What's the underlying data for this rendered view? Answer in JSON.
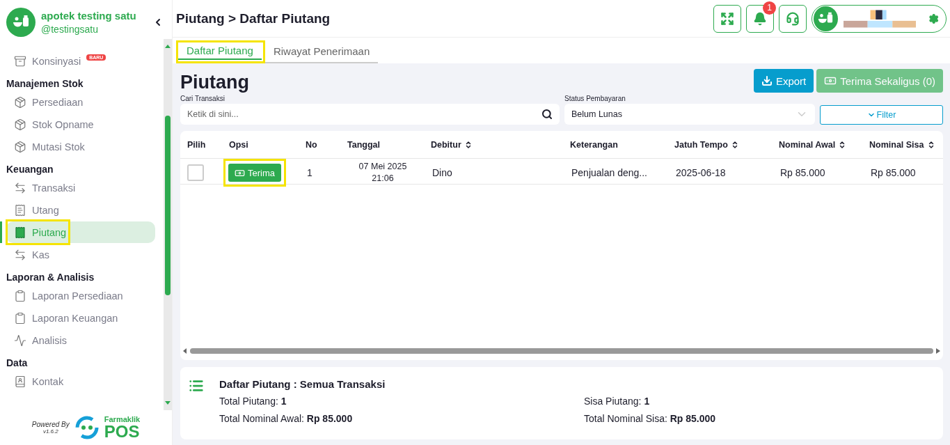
{
  "sidebar": {
    "store_name": "apotek testing satu",
    "handle": "@testingsatu",
    "sections": [
      {
        "items": [
          {
            "label": "Konsinyasi",
            "badge": "BARU",
            "selected": false,
            "highlighted": false
          }
        ]
      },
      {
        "heading": "Manajemen Stok",
        "items": [
          {
            "label": "Persediaan",
            "selected": false,
            "highlighted": false
          },
          {
            "label": "Stok Opname",
            "selected": false,
            "highlighted": false
          },
          {
            "label": "Mutasi Stok",
            "selected": false,
            "highlighted": false
          }
        ]
      },
      {
        "heading": "Keuangan",
        "items": [
          {
            "label": "Transaksi",
            "selected": false,
            "highlighted": false
          },
          {
            "label": "Utang",
            "selected": false,
            "highlighted": false
          },
          {
            "label": "Piutang",
            "selected": true,
            "highlighted": true
          },
          {
            "label": "Kas",
            "selected": false,
            "highlighted": false
          }
        ]
      },
      {
        "heading": "Laporan & Analisis",
        "items": [
          {
            "label": "Laporan Persediaan",
            "selected": false,
            "highlighted": false
          },
          {
            "label": "Laporan Keuangan",
            "selected": false,
            "highlighted": false
          },
          {
            "label": "Analisis",
            "selected": false,
            "highlighted": false
          }
        ]
      },
      {
        "heading": "Data",
        "items": [
          {
            "label": "Kontak",
            "selected": false,
            "highlighted": false
          }
        ]
      }
    ],
    "powered_by": "Powered By",
    "version": "v1.6.2",
    "brand": "Farmaklik",
    "brand_sub": "POS"
  },
  "header": {
    "breadcrumb": "Piutang > Daftar Piutang",
    "notification_count": "1"
  },
  "tabs": [
    {
      "label": "Daftar Piutang",
      "selected": true,
      "highlighted": true
    },
    {
      "label": "Riwayat Penerimaan",
      "selected": false,
      "highlighted": false
    }
  ],
  "page_title": "Piutang",
  "actions": [
    {
      "label": "Export",
      "kind": "export",
      "disabled": false
    },
    {
      "label": "Terima Sekaligus (0)",
      "kind": "receive",
      "disabled": true
    }
  ],
  "search": {
    "label": "Cari Transaksi",
    "placeholder": "Ketik di sini..."
  },
  "status_filter": {
    "label": "Status Pembayaran",
    "value": "Belum Lunas"
  },
  "filter_button": "Filter",
  "table": {
    "columns": [
      {
        "label": "Pilih",
        "sortable": false
      },
      {
        "label": "Opsi",
        "sortable": false
      },
      {
        "label": "No",
        "sortable": false
      },
      {
        "label": "Tanggal",
        "sortable": false
      },
      {
        "label": "Debitur",
        "sortable": true
      },
      {
        "label": "Keterangan",
        "sortable": false
      },
      {
        "label": "Jatuh Tempo",
        "sortable": true
      },
      {
        "label": "Nominal Awal",
        "sortable": true
      },
      {
        "label": "Nominal Sisa",
        "sortable": true
      }
    ],
    "rows": [
      {
        "checked": false,
        "action": "Terima",
        "action_highlighted": true,
        "no": "1",
        "date": "07 Mei 2025",
        "time": "21:06",
        "debtor": "Dino",
        "description": "Penjualan deng...",
        "due": "2025-06-18",
        "initial": "Rp 85.000",
        "remaining": "Rp 85.000"
      }
    ]
  },
  "summary": {
    "title": "Daftar Piutang : Semua Transaksi",
    "stats": [
      {
        "label": "Total Piutang: ",
        "value": "1"
      },
      {
        "label": "Sisa Piutang: ",
        "value": "1"
      },
      {
        "label": "Total Nominal Awal: ",
        "value": "Rp 85.000"
      },
      {
        "label": "Total Nominal Sisa: ",
        "value": "Rp 85.000"
      }
    ]
  }
}
